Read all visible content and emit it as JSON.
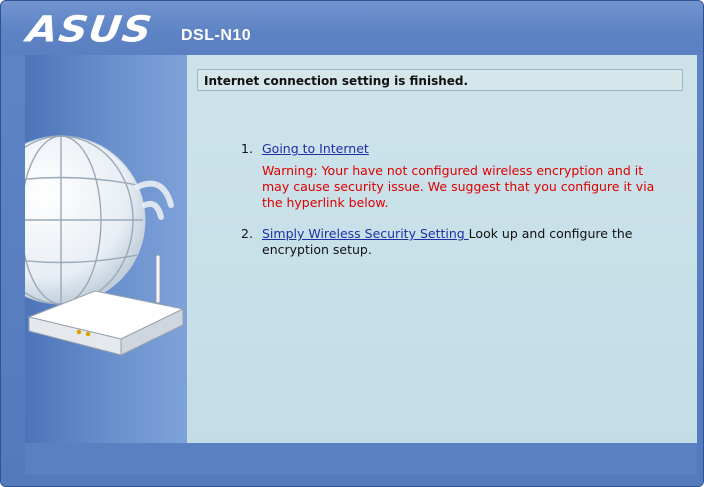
{
  "header": {
    "brand": "ASUS",
    "model": "DSL-N10"
  },
  "main": {
    "notice": "Internet connection setting is finished.",
    "items": [
      {
        "number": "1.",
        "link": "Going to Internet",
        "warning": "Warning: Your have not configured wireless encryption and it may cause security issue. We suggest that you configure it via the hyperlink below."
      },
      {
        "number": "2.",
        "link": "Simply Wireless Security Setting ",
        "text": "Look up and configure the encryption setup."
      }
    ]
  },
  "colors": {
    "frame_blue": "#5a80c2",
    "content_bg": "#c8e0e8",
    "link": "#1f2fa6",
    "warning": "#dd0000"
  },
  "icons": {
    "side_illustration": "globe-router-illustration"
  }
}
